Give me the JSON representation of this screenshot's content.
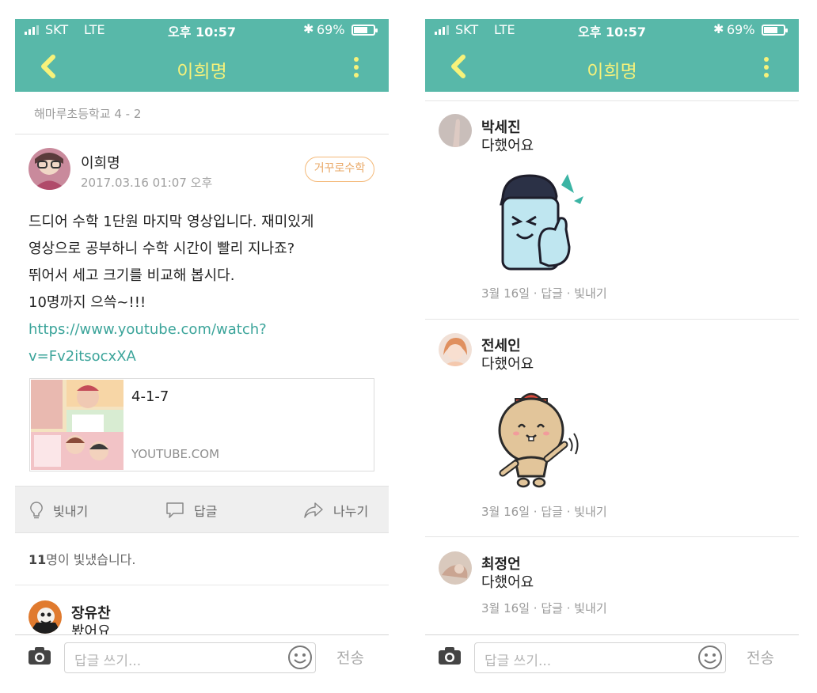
{
  "colors": {
    "brand": "#58b8a9",
    "title": "#f7f27a",
    "link": "#3ba49a",
    "tag_border": "#f4b979"
  },
  "left": {
    "status": {
      "carrier": "SKT",
      "network": "LTE",
      "time": "오후 10:57",
      "battery": "69%",
      "battery_level": 0.69
    },
    "nav": {
      "title": "이희명",
      "back_icon": "chevron-left-icon",
      "more_icon": "more-vertical-icon"
    },
    "group": "해마루초등학교 4 - 2",
    "post": {
      "author": "이희명",
      "date": "2017.03.16 01:07 오후",
      "tag": "거꾸로수학",
      "lines": [
        "드디어 수학 1단원 마지막 영상입니다. 재미있게",
        "영상으로 공부하니 수학 시간이 빨리 지나죠?",
        "뛰어서 세고 크기를 비교해 봅시다.",
        "10명까지 으쓱~!!!"
      ],
      "link_lines": [
        "https://www.youtube.com/watch?",
        "v=Fv2itsocxXA"
      ],
      "card": {
        "title": "4-1-7",
        "domain": "YOUTUBE.COM"
      }
    },
    "actions": {
      "shine": "빛내기",
      "reply": "답글",
      "share": "나누기"
    },
    "likes": {
      "count": "11",
      "suffix": "명이 빛냈습니다."
    },
    "comment": {
      "name": "장유찬",
      "text": "봤어요"
    },
    "input": {
      "placeholder": "답글 쓰기...",
      "send": "전송"
    }
  },
  "right": {
    "status": {
      "carrier": "SKT",
      "network": "LTE",
      "time": "오후 10:57",
      "battery": "69%",
      "battery_level": 0.69
    },
    "nav": {
      "title": "이희명",
      "back_icon": "chevron-left-icon",
      "more_icon": "more-vertical-icon"
    },
    "comments": [
      {
        "name": "박세진",
        "text": "다했어요",
        "sticker": "thumbs-up-character-sticker",
        "date": "3월 16일",
        "reply": "답글",
        "shine": "빛내기"
      },
      {
        "name": "전세인",
        "text": "다했어요",
        "sticker": "waving-hamster-sticker",
        "date": "3월 16일",
        "reply": "답글",
        "shine": "빛내기"
      },
      {
        "name": "최정언",
        "text": "다했어요",
        "date": "3월 16일",
        "reply": "답글",
        "shine": "빛내기"
      }
    ],
    "input": {
      "placeholder": "답글 쓰기...",
      "send": "전송"
    }
  }
}
